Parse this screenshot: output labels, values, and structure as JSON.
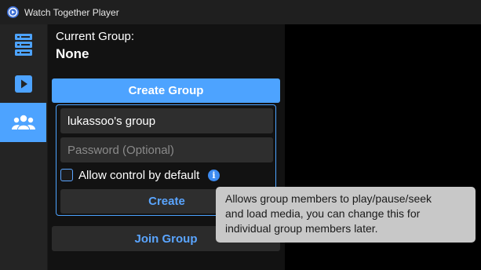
{
  "window": {
    "title": "Watch Together Player"
  },
  "sidebar": {
    "items": [
      {
        "icon": "server-list-icon",
        "active": false
      },
      {
        "icon": "play-icon",
        "active": false
      },
      {
        "icon": "group-icon",
        "active": true
      }
    ]
  },
  "group": {
    "current_label": "Current Group:",
    "current_value": "None",
    "create_group_label": "Create Group",
    "name_value": "lukassoo's group",
    "password_placeholder": "Password (Optional)",
    "allow_control_label": "Allow control by default",
    "allow_control_checked": false,
    "create_label": "Create",
    "join_group_label": "Join Group",
    "tooltip_lines": [
      "Allows group members to play/pause/seek",
      "and load media, you can change this for",
      "individual group members later."
    ]
  },
  "colors": {
    "accent": "#4da3ff",
    "background": "#121212",
    "sidebar": "#242424",
    "tooltip": "#c8c8c8"
  }
}
